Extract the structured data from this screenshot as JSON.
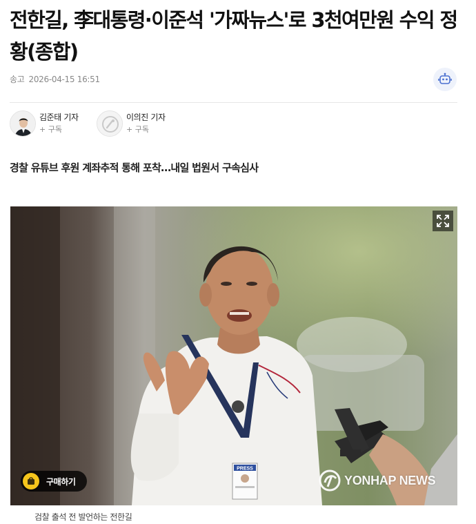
{
  "article": {
    "headline": "전한길, 李대통령·이준석 '가짜뉴스'로 3천여만원 수익 정황(종합)",
    "sent_label": "송고",
    "timestamp": "2026-04-15 16:51",
    "subtitle": "경찰 유튜브 후원 계좌추적 통해 포착…내일 법원서 구속심사"
  },
  "reporters": [
    {
      "name": "김준태 기자",
      "subscribe": "+ 구독"
    },
    {
      "name": "이의진 기자",
      "subscribe": "+ 구독"
    }
  ],
  "photo": {
    "buy_label": "구매하기",
    "watermark": "YONHAP NEWS",
    "caption": "검찰 출석 전 발언하는 전한길",
    "press_badge": "PRESS"
  },
  "icons": {
    "robot": "robot-icon",
    "expand": "expand-icon",
    "buy": "yonhap-buy-icon",
    "watermark": "yonhap-logo-icon"
  },
  "colors": {
    "accent": "#f5c51c",
    "robot_bg": "#eef2fb",
    "robot_icon": "#4a6fd0"
  }
}
